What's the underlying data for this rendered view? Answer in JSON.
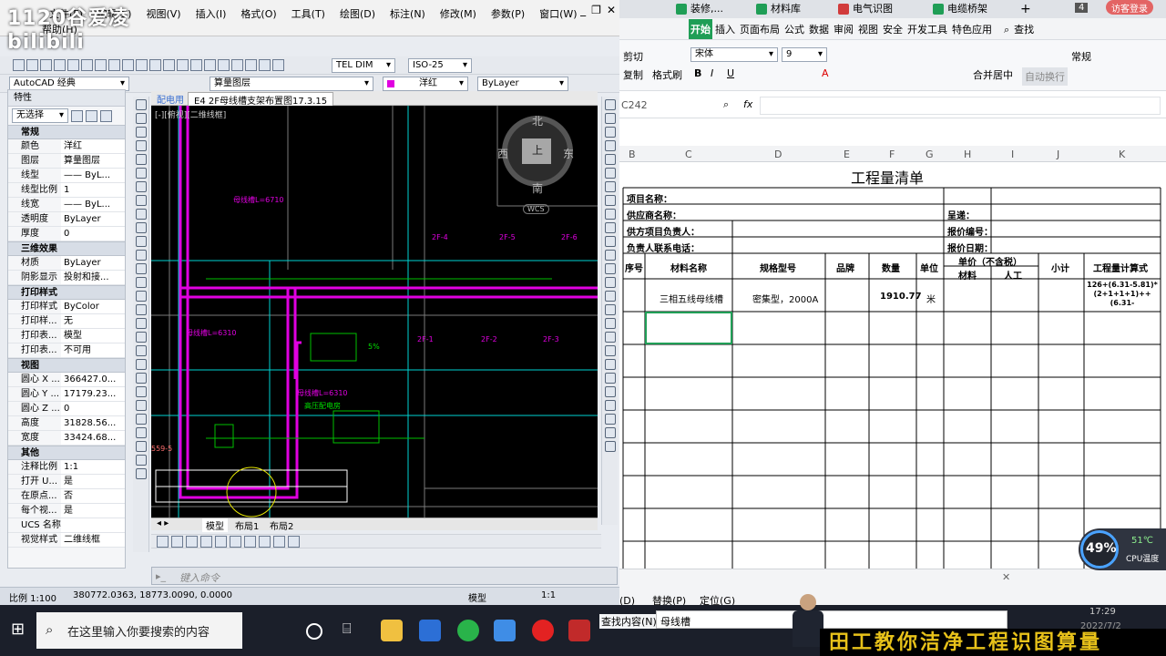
{
  "cad": {
    "logo": "1120谷爱凌 bilibili",
    "menu": [
      "文件(F)",
      "编辑(E)",
      "视图(V)",
      "插入(I)",
      "格式(O)",
      "工具(T)",
      "绘图(D)",
      "标注(N)",
      "修改(M)",
      "参数(P)",
      "窗口(W)"
    ],
    "menu2": "帮助(H)",
    "workspace": "AutoCAD 经典",
    "layer_combo": "算量图层",
    "color_combo": "洋红",
    "linetype_combo": "ByLayer",
    "dimstyle_combo": "TEL DIM",
    "scale_combo": "ISO-25",
    "props_title": "特性",
    "props_select": "无选择",
    "groups": [
      {
        "name": "常规",
        "rows": [
          [
            "颜色",
            "洋红"
          ],
          [
            "图层",
            "算量图层"
          ],
          [
            "线型",
            "—— ByL..."
          ],
          [
            "线型比例",
            "1"
          ],
          [
            "线宽",
            "—— ByL..."
          ],
          [
            "透明度",
            "ByLayer"
          ],
          [
            "厚度",
            "0"
          ]
        ]
      },
      {
        "name": "三维效果",
        "rows": [
          [
            "材质",
            "ByLayer"
          ],
          [
            "阴影显示",
            "投射和接..."
          ]
        ]
      },
      {
        "name": "打印样式",
        "rows": [
          [
            "打印样式",
            "ByColor"
          ],
          [
            "打印样...",
            "无"
          ],
          [
            "打印表...",
            "模型"
          ],
          [
            "打印表...",
            "不可用"
          ]
        ]
      },
      {
        "name": "视图",
        "rows": [
          [
            "圆心 X ...",
            "366427.0..."
          ],
          [
            "圆心 Y ...",
            "17179.23..."
          ],
          [
            "圆心 Z ...",
            "0"
          ],
          [
            "高度",
            "31828.56..."
          ],
          [
            "宽度",
            "33424.68..."
          ]
        ]
      },
      {
        "name": "其他",
        "rows": [
          [
            "注释比例",
            "1:1"
          ],
          [
            "打开 U...",
            "是"
          ],
          [
            "在原点...",
            "否"
          ],
          [
            "每个视...",
            "是"
          ],
          [
            "UCS 名称",
            ""
          ],
          [
            "视觉样式",
            "二维线框"
          ]
        ]
      }
    ],
    "doc_tabs": [
      "配电用",
      "E4 2F母线槽支架布置图17.3.15"
    ],
    "viewport_label": "[-][俯视][二维线框]",
    "viewcube": {
      "n": "北",
      "s": "南",
      "e": "东",
      "w": "西",
      "top": "上",
      "wcs": "WCS"
    },
    "layout_tabs": [
      "模型",
      "布局1",
      "布局2"
    ],
    "cmd_placeholder": "键入命令",
    "status": {
      "scale": "比例 1:100",
      "coords": "380772.0363, 18773.0090, 0.0000",
      "model": "模型",
      "ratio": "1:1"
    },
    "drawing_labels": [
      "母线槽L=6710",
      "2F-4",
      "2F-5",
      "2F-6",
      "母线槽L=6310",
      "2F-1",
      "2F-2",
      "2F-3",
      "母线槽L=6310",
      "高压配电房",
      "5%",
      "559-5"
    ]
  },
  "wps": {
    "tabs": [
      "装修,...",
      "材料库",
      "电气识图",
      "电缆桥架"
    ],
    "tab_count": "4",
    "visitor": "访客登录",
    "ribbon_tabs": [
      "开始",
      "插入",
      "页面布局",
      "公式",
      "数据",
      "审阅",
      "视图",
      "安全",
      "开发工具",
      "特色应用"
    ],
    "search": "查找",
    "font": "宋体",
    "font_size": "9",
    "merge": "合并居中",
    "wrap": "自动换行",
    "number_format": "常规",
    "cut": "剪切",
    "copy": "复制",
    "paint": "格式刷",
    "start_btn": "开始",
    "cell_ref": "C242",
    "fx": "fx",
    "columns": [
      "B",
      "C",
      "D",
      "E",
      "F",
      "G",
      "H",
      "I",
      "J",
      "K"
    ],
    "sheet": {
      "title": "工程量清单",
      "project_name": "项目名称：",
      "supplier": "供应商名称：",
      "supplier_lead": "供方项目负责人：",
      "lead_phone": "负责人联系电话：",
      "submit": "呈递：",
      "quote_no": "报价编号：",
      "quote_date": "报价日期：",
      "headers": [
        "序号",
        "材料名称",
        "规格型号",
        "品牌",
        "数量",
        "单位",
        "单价（不含税）",
        "材料",
        "人工",
        "小计",
        "工程量计算式"
      ],
      "row1": {
        "name": "三相五线母线槽",
        "spec": "密集型，2000A",
        "qty": "1910.77",
        "unit": "米",
        "formula": "126+(6.31-5.81)*(2+1+1+1)++(6.31-"
      }
    },
    "find": {
      "tabs": [
        "查找(D)",
        "替换(P)",
        "定位(G)"
      ],
      "label": "查找内容(N):",
      "value": "母线槽"
    }
  },
  "taskbar": {
    "search": "在这里输入你要搜索的内容",
    "time": "17:29",
    "date": "2022/7/2"
  },
  "cpu": {
    "percent": "49%",
    "temp": "51℃",
    "label": "CPU温度"
  },
  "banner": "田工教你洁净工程识图算量"
}
